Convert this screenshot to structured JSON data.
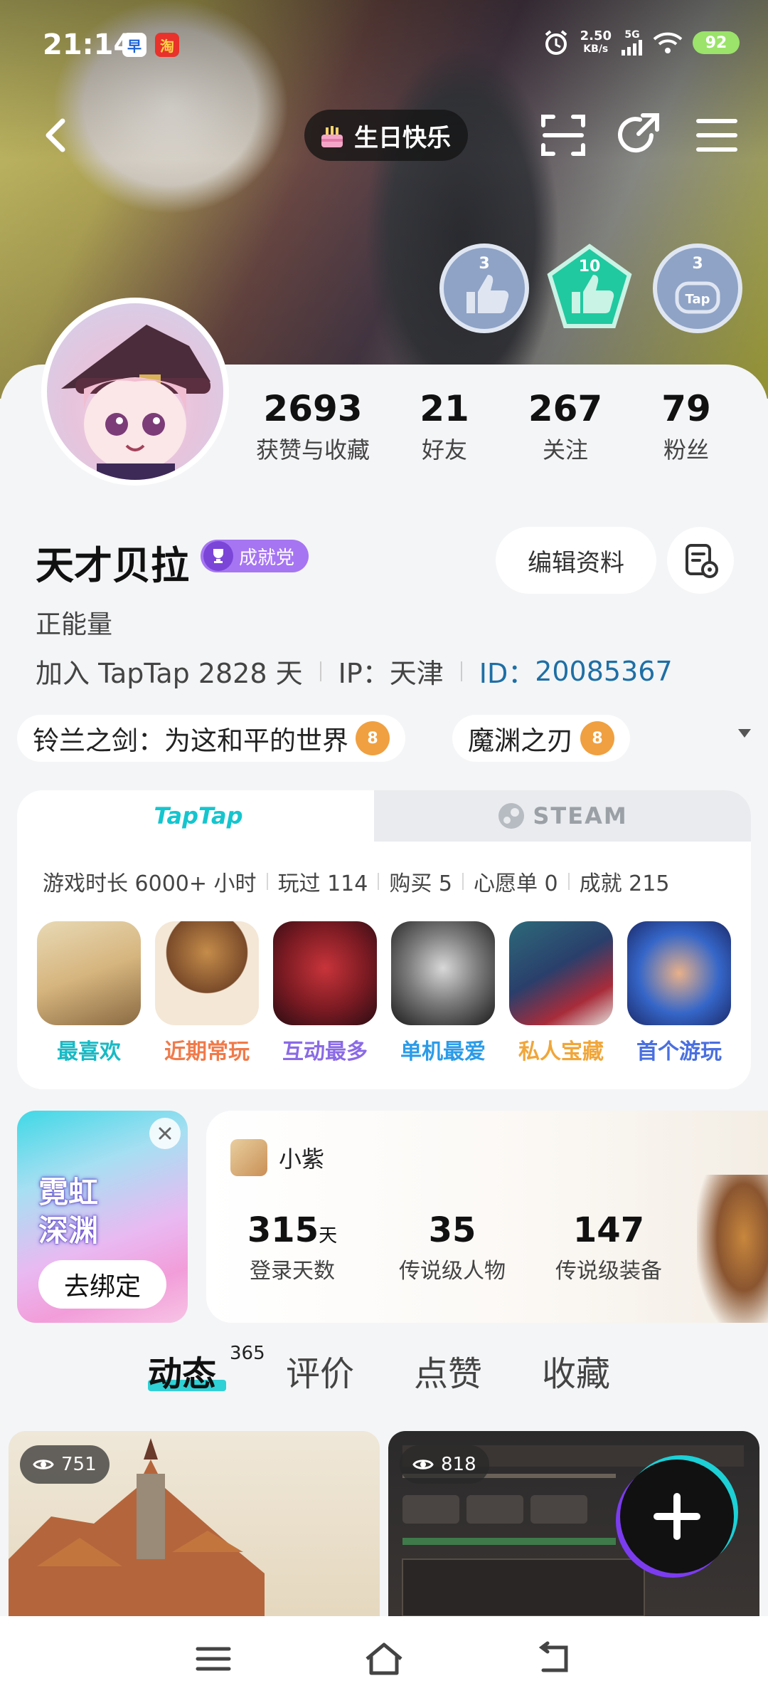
{
  "status_bar": {
    "time": "21:14",
    "net_speed": "2.50",
    "net_unit": "KB/s",
    "network": "5G",
    "battery": "92",
    "app_badge_1": "早",
    "app_badge_2": "淘"
  },
  "topnav": {
    "birthday_label": "生日快乐"
  },
  "badges": [
    {
      "level": "3",
      "color": "#8ea3c6"
    },
    {
      "level": "10",
      "color": "#20c9a0"
    },
    {
      "level": "3",
      "color": "#8ea3c6",
      "sub": "Tap"
    }
  ],
  "stats": [
    {
      "value": "2693",
      "label": "获赞与收藏"
    },
    {
      "value": "21",
      "label": "好友"
    },
    {
      "value": "267",
      "label": "关注"
    },
    {
      "value": "79",
      "label": "粉丝"
    }
  ],
  "profile": {
    "name": "天才贝拉",
    "achievement_badge": "成就党",
    "edit_button": "编辑资料",
    "bio": "正能量",
    "join_text": "加入 TapTap 2828 天",
    "ip_text": "IP：天津",
    "id_label": "ID：",
    "id_value": "20085367"
  },
  "favorite_games": [
    {
      "name": "铃兰之剑：为这和平的世界",
      "level": "8"
    },
    {
      "name": "魔渊之刃",
      "level": "8"
    }
  ],
  "platform_tabs": {
    "taptap": "TapTap",
    "steam": "STEAM"
  },
  "play_summary": [
    "游戏时长 6000+ 小时",
    "玩过 114",
    "购买 5",
    "心愿单 0",
    "成就 215"
  ],
  "game_tiles": [
    {
      "label": "最喜欢",
      "color": "#19b9c4"
    },
    {
      "label": "近期常玩",
      "color": "#f07a4a"
    },
    {
      "label": "互动最多",
      "color": "#8a6ae6"
    },
    {
      "label": "单机最爱",
      "color": "#2b9be8"
    },
    {
      "label": "私人宝藏",
      "color": "#f0a63a"
    },
    {
      "label": "首个游玩",
      "color": "#4a6fe0"
    }
  ],
  "bind_card": {
    "logo_line1": "霓虹",
    "logo_line2": "深渊",
    "button": "去绑定"
  },
  "char_card": {
    "name": "小紫",
    "stats": [
      {
        "value": "315",
        "unit": "天",
        "label": "登录天数"
      },
      {
        "value": "35",
        "unit": "",
        "label": "传说级人物"
      },
      {
        "value": "147",
        "unit": "",
        "label": "传说级装备"
      }
    ]
  },
  "content_tabs": [
    {
      "label": "动态",
      "count": "365"
    },
    {
      "label": "评价"
    },
    {
      "label": "点赞"
    },
    {
      "label": "收藏"
    }
  ],
  "feed": [
    {
      "views": "751"
    },
    {
      "views": "818"
    }
  ]
}
